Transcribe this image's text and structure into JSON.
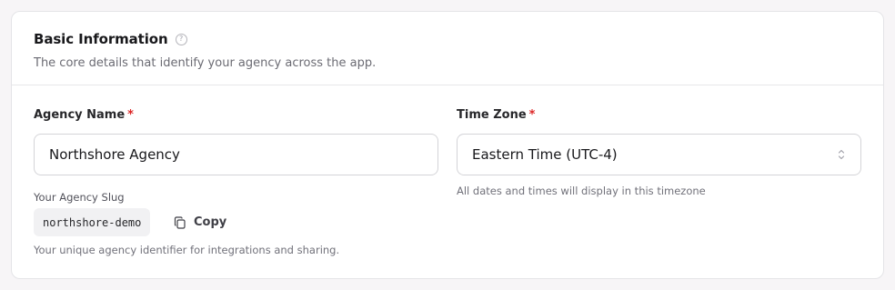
{
  "section": {
    "title": "Basic Information",
    "subtitle": "The core details that identify your agency across the app.",
    "help_icon": "question-circle-icon"
  },
  "agency_name": {
    "label": "Agency Name",
    "required_marker": "*",
    "value": "Northshore Agency"
  },
  "time_zone": {
    "label": "Time Zone",
    "required_marker": "*",
    "value": "Eastern Time (UTC-4)",
    "helper": "All dates and times will display in this timezone"
  },
  "slug": {
    "label": "Your Agency Slug",
    "value": "northshore-demo",
    "copy_label": "Copy",
    "copy_icon": "copy-icon",
    "helper": "Your unique agency identifier for integrations and sharing."
  },
  "colors": {
    "required": "#dc2626",
    "border": "#d4d4d8",
    "chip_bg": "#f1f1f3"
  }
}
